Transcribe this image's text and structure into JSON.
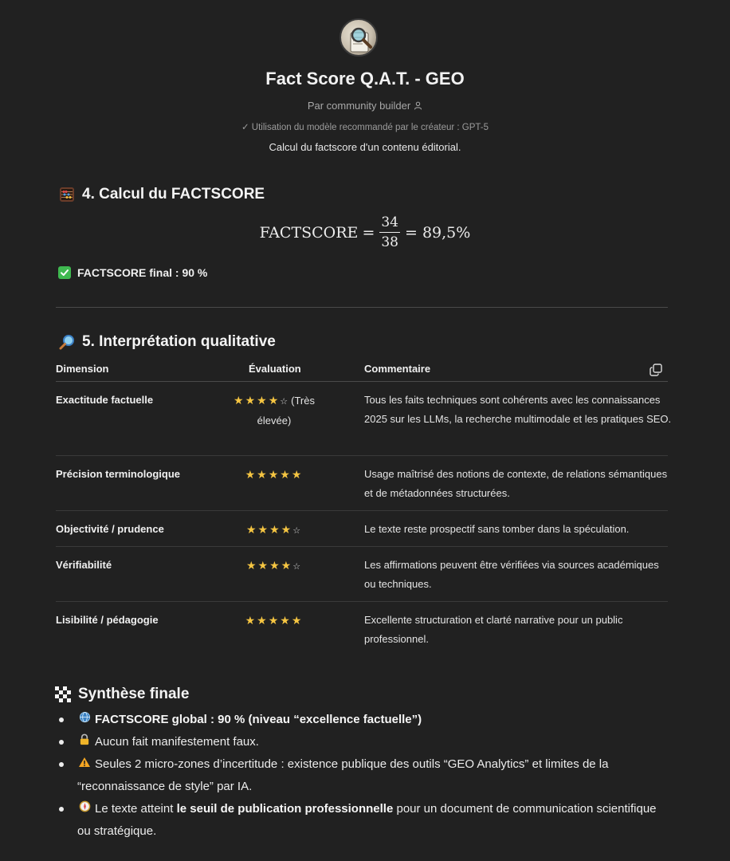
{
  "header": {
    "title": "Fact Score Q.A.T. - GEO",
    "byline": "Par community builder",
    "model_note": "✓ Utilisation du modèle recommandé par le créateur : GPT-5",
    "description": "Calcul du factscore d'un contenu éditorial."
  },
  "section4": {
    "heading": "4. Calcul du FACTSCORE",
    "formula": {
      "lhs": "FACTSCORE",
      "eq": "=",
      "numerator": "34",
      "denominator": "38",
      "result": "= 89,5%"
    },
    "final": "FACTSCORE final : 90 %"
  },
  "section5": {
    "heading": "5. Interprétation qualitative",
    "columns": {
      "dimension": "Dimension",
      "evaluation": "Évaluation",
      "comment": "Commentaire"
    },
    "rows": [
      {
        "dimension": "Exactitude factuelle",
        "stars": 4,
        "suffix": "(Très élevée)",
        "comment": "Tous les faits techniques sont cohérents avec les connaissances 2025 sur les LLMs, la recherche multimodale et les pratiques SEO."
      },
      {
        "dimension": "Précision terminologique",
        "stars": 5,
        "suffix": "",
        "comment": "Usage maîtrisé des notions de contexte, de relations sémantiques et de métadonnées structurées."
      },
      {
        "dimension": "Objectivité / prudence",
        "stars": 4,
        "suffix": "",
        "comment": "Le texte reste prospectif sans tomber dans la spéculation."
      },
      {
        "dimension": "Vérifiabilité",
        "stars": 4,
        "suffix": "",
        "comment": "Les affirmations peuvent être vérifiées via sources académiques ou techniques."
      },
      {
        "dimension": "Lisibilité / pédagogie",
        "stars": 5,
        "suffix": "",
        "comment": "Excellente structuration et clarté narrative pour un public professionnel."
      }
    ]
  },
  "synthese": {
    "heading": "Synthèse finale",
    "items": [
      {
        "icon": "globe-icon",
        "bold": "FACTSCORE global : 90 % (niveau “excellence factuelle”)",
        "text": ""
      },
      {
        "icon": "lock-icon",
        "bold": "",
        "text": "Aucun fait manifestement faux."
      },
      {
        "icon": "warning-icon",
        "bold": "",
        "text": "Seules 2 micro-zones d’incertitude : existence publique des outils “GEO Analytics” et limites de la “reconnaissance de style” par IA."
      },
      {
        "icon": "compass-icon",
        "pre": "Le texte atteint ",
        "bold": "le seuil de publication professionnelle",
        "text": " pour un document de communication scientifique ou stratégique."
      }
    ]
  },
  "colors": {
    "background": "#212121",
    "star": "#f5c542",
    "check": "#3fb950"
  }
}
